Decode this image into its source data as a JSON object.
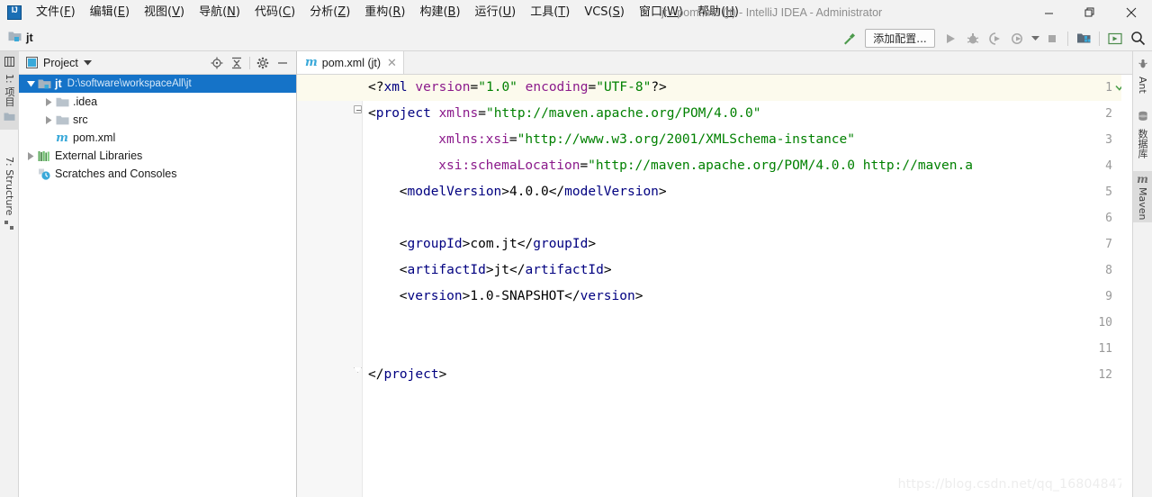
{
  "window": {
    "title": "jt - pom.xml (jt) - IntelliJ IDEA - Administrator",
    "logo": "intellij-idea-logo",
    "minimize": "—",
    "maximize": "❐",
    "close": "✕"
  },
  "menu": [
    {
      "label": "文件",
      "mnemonic": "F"
    },
    {
      "label": "编辑",
      "mnemonic": "E"
    },
    {
      "label": "视图",
      "mnemonic": "V"
    },
    {
      "label": "导航",
      "mnemonic": "N"
    },
    {
      "label": "代码",
      "mnemonic": "C"
    },
    {
      "label": "分析",
      "mnemonic": "Z"
    },
    {
      "label": "重构",
      "mnemonic": "R"
    },
    {
      "label": "构建",
      "mnemonic": "B"
    },
    {
      "label": "运行",
      "mnemonic": "U"
    },
    {
      "label": "工具",
      "mnemonic": "T"
    },
    {
      "label": "VCS",
      "mnemonic": "S"
    },
    {
      "label": "窗口",
      "mnemonic": "W"
    },
    {
      "label": "帮助",
      "mnemonic": "H"
    }
  ],
  "navbar": {
    "breadcrumb": "jt",
    "project_icon": "module-folder-icon"
  },
  "toolbar": {
    "build_icon": "hammer-icon",
    "add_config_label": "添加配置...",
    "run_icon": "run-icon",
    "debug_icon": "debug-icon",
    "run_coverage_icon": "run-with-coverage-icon",
    "profile_icon": "profile-icon",
    "profile_dropdown_icon": "chevron-down-icon",
    "stop_icon": "stop-icon",
    "project_structure_icon": "project-structure-icon",
    "select_in_icon": "select-in-icon",
    "search_icon": "search-icon"
  },
  "left_strip": [
    {
      "label": "1: 项目",
      "icon": "project-icon",
      "selected": true
    },
    {
      "label": "7: Structure",
      "icon": "structure-icon",
      "selected": false
    }
  ],
  "right_strip": [
    {
      "label": "Ant",
      "icon": "ant-icon",
      "selected": false
    },
    {
      "label": "数据库",
      "icon": "database-icon",
      "selected": false
    },
    {
      "label": "Maven",
      "icon": "maven-icon",
      "selected": true
    }
  ],
  "project_panel": {
    "title": "Project",
    "dropdown_icon": "chevron-down-icon",
    "panel_icon": "project-window-icon",
    "actions": [
      {
        "name": "locate-icon"
      },
      {
        "name": "collapse-all-icon"
      },
      {
        "name": "settings-gear-icon"
      },
      {
        "name": "hide-icon"
      }
    ],
    "tree": [
      {
        "label": "jt",
        "path": "D:\\software\\workspaceAll\\jt",
        "icon": "module-folder-icon",
        "indent": 0,
        "arrow": "expanded",
        "selected": true,
        "bold": true
      },
      {
        "label": ".idea",
        "path": "",
        "icon": "folder-icon",
        "indent": 1,
        "arrow": "collapsed",
        "selected": false,
        "bold": false
      },
      {
        "label": "src",
        "path": "",
        "icon": "folder-icon",
        "indent": 1,
        "arrow": "collapsed",
        "selected": false,
        "bold": false
      },
      {
        "label": "pom.xml",
        "path": "",
        "icon": "maven-file-icon",
        "indent": 1,
        "arrow": "none",
        "selected": false,
        "bold": false
      },
      {
        "label": "External Libraries",
        "path": "",
        "icon": "libraries-icon",
        "indent": 0,
        "arrow": "collapsed",
        "selected": false,
        "bold": false
      },
      {
        "label": "Scratches and Consoles",
        "path": "",
        "icon": "scratches-icon",
        "indent": 0,
        "arrow": "none",
        "selected": false,
        "bold": false
      }
    ]
  },
  "editor": {
    "tab": {
      "label": "pom.xml (jt)",
      "icon": "maven-file-icon",
      "close_icon": "close-icon"
    },
    "inspection_status_icon": "inspection-ok-check",
    "watermark": "https://blog.csdn.net/qq_16804847",
    "line_numbers": [
      "1",
      "2",
      "3",
      "4",
      "5",
      "6",
      "7",
      "8",
      "9",
      "10",
      "11",
      "12"
    ],
    "current_line": 1,
    "lines": [
      {
        "n": 1,
        "indent": 0,
        "tokens": [
          {
            "t": "<?",
            "c": "t-punct"
          },
          {
            "t": "xml",
            "c": "t-proc"
          },
          {
            "t": " ",
            "c": "t-text"
          },
          {
            "t": "version",
            "c": "t-attr"
          },
          {
            "t": "=",
            "c": "t-punct"
          },
          {
            "t": "\"1.0\"",
            "c": "t-val"
          },
          {
            "t": " ",
            "c": "t-text"
          },
          {
            "t": "encoding",
            "c": "t-attr"
          },
          {
            "t": "=",
            "c": "t-punct"
          },
          {
            "t": "\"UTF-8\"",
            "c": "t-val"
          },
          {
            "t": "?>",
            "c": "t-punct"
          }
        ]
      },
      {
        "n": 2,
        "indent": 0,
        "tokens": [
          {
            "t": "<",
            "c": "t-punct"
          },
          {
            "t": "project",
            "c": "t-tag"
          },
          {
            "t": " ",
            "c": "t-text"
          },
          {
            "t": "xmlns",
            "c": "t-attr"
          },
          {
            "t": "=",
            "c": "t-punct"
          },
          {
            "t": "\"http://maven.apache.org/POM/4.0.0\"",
            "c": "t-val"
          }
        ]
      },
      {
        "n": 3,
        "indent": 9,
        "tokens": [
          {
            "t": "xmlns:xsi",
            "c": "t-attr"
          },
          {
            "t": "=",
            "c": "t-punct"
          },
          {
            "t": "\"http://www.w3.org/2001/XMLSchema-instance\"",
            "c": "t-val"
          }
        ]
      },
      {
        "n": 4,
        "indent": 9,
        "tokens": [
          {
            "t": "xsi:schemaLocation",
            "c": "t-attr"
          },
          {
            "t": "=",
            "c": "t-punct"
          },
          {
            "t": "\"http://maven.apache.org/POM/4.0.0 http://maven.a",
            "c": "t-val"
          }
        ]
      },
      {
        "n": 5,
        "indent": 4,
        "tokens": [
          {
            "t": "<",
            "c": "t-punct"
          },
          {
            "t": "modelVersion",
            "c": "t-tag"
          },
          {
            "t": ">",
            "c": "t-punct"
          },
          {
            "t": "4.0.0",
            "c": "t-text"
          },
          {
            "t": "</",
            "c": "t-punct"
          },
          {
            "t": "modelVersion",
            "c": "t-tag"
          },
          {
            "t": ">",
            "c": "t-punct"
          }
        ]
      },
      {
        "n": 6,
        "indent": 0,
        "tokens": []
      },
      {
        "n": 7,
        "indent": 4,
        "tokens": [
          {
            "t": "<",
            "c": "t-punct"
          },
          {
            "t": "groupId",
            "c": "t-tag"
          },
          {
            "t": ">",
            "c": "t-punct"
          },
          {
            "t": "com.jt",
            "c": "t-text"
          },
          {
            "t": "</",
            "c": "t-punct"
          },
          {
            "t": "groupId",
            "c": "t-tag"
          },
          {
            "t": ">",
            "c": "t-punct"
          }
        ]
      },
      {
        "n": 8,
        "indent": 4,
        "tokens": [
          {
            "t": "<",
            "c": "t-punct"
          },
          {
            "t": "artifactId",
            "c": "t-tag"
          },
          {
            "t": ">",
            "c": "t-punct"
          },
          {
            "t": "jt",
            "c": "t-text"
          },
          {
            "t": "</",
            "c": "t-punct"
          },
          {
            "t": "artifactId",
            "c": "t-tag"
          },
          {
            "t": ">",
            "c": "t-punct"
          }
        ]
      },
      {
        "n": 9,
        "indent": 4,
        "tokens": [
          {
            "t": "<",
            "c": "t-punct"
          },
          {
            "t": "version",
            "c": "t-tag"
          },
          {
            "t": ">",
            "c": "t-punct"
          },
          {
            "t": "1.0-SNAPSHOT",
            "c": "t-text"
          },
          {
            "t": "</",
            "c": "t-punct"
          },
          {
            "t": "version",
            "c": "t-tag"
          },
          {
            "t": ">",
            "c": "t-punct"
          }
        ]
      },
      {
        "n": 10,
        "indent": 0,
        "tokens": []
      },
      {
        "n": 11,
        "indent": 0,
        "tokens": []
      },
      {
        "n": 12,
        "indent": 0,
        "tokens": [
          {
            "t": "</",
            "c": "t-punct"
          },
          {
            "t": "project",
            "c": "t-tag"
          },
          {
            "t": ">",
            "c": "t-punct"
          }
        ]
      }
    ]
  },
  "colors": {
    "selection_blue": "#1573c8",
    "chrome_gray": "#f2f2f2",
    "editor_bg": "#ffffff",
    "current_line": "#fcfaed",
    "xml_tag": "#000080",
    "xml_attr": "#8b1a8b",
    "xml_value": "#008000",
    "maven_icon": "#3aa9d9"
  }
}
